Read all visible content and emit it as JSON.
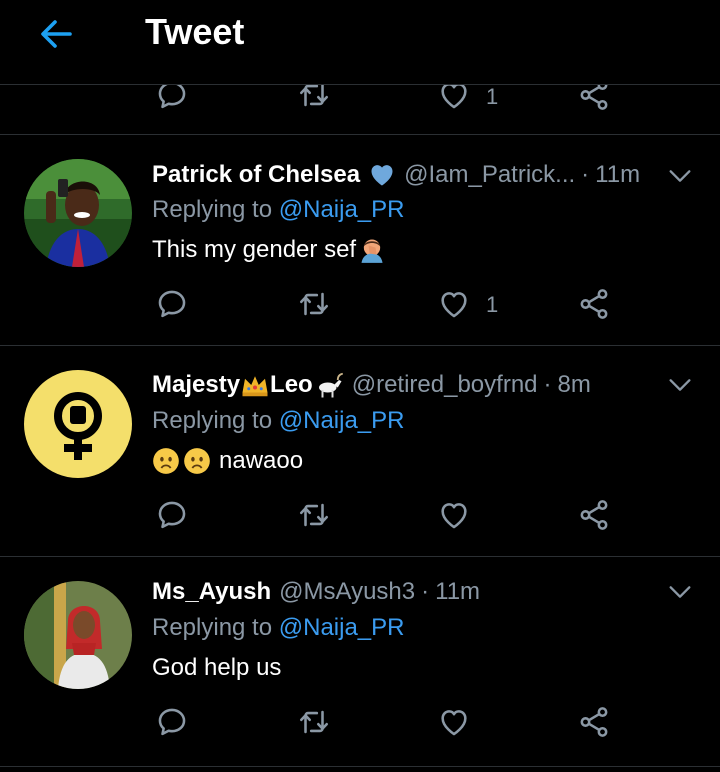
{
  "header": {
    "title": "Tweet",
    "back_icon": "arrow-left-icon"
  },
  "colors": {
    "accent": "#1da1f2",
    "link": "#3b9cf0",
    "muted": "#8b98a5",
    "background": "#000000",
    "divider": "#2b2f33",
    "verified_heart": "#6fa8dc",
    "avatar_majesty_bg": "#f4df6b"
  },
  "top_partial": {
    "like_count": "1"
  },
  "tweets": [
    {
      "name": "Patrick of Chelsea",
      "name_badge": "blue-heart-emoji",
      "handle": "@Iam_Patrick...",
      "dot": "·",
      "time": "11m",
      "replying_prefix": "Replying to ",
      "replying_to": "@Naija_PR",
      "text": "This my gender sef",
      "text_emoji": "facepalm-emoji",
      "like_count": "1"
    },
    {
      "name_a": "Majesty",
      "name_b": "Leo",
      "name_emojis": [
        "crown-emoji",
        "goat-emoji"
      ],
      "handle": "@retired_boyfrnd",
      "dot": "·",
      "time": "8m",
      "replying_prefix": "Replying to ",
      "replying_to": "@Naija_PR",
      "text": "nawaoo",
      "text_emojis": [
        "worried-face-emoji",
        "worried-face-emoji"
      ],
      "like_count": ""
    },
    {
      "name": "Ms_Ayush",
      "handle": "@MsAyush3",
      "dot": "·",
      "time": "11m",
      "replying_prefix": "Replying to ",
      "replying_to": "@Naija_PR",
      "text": "God help us",
      "like_count": ""
    }
  ],
  "action_icons": [
    "reply-icon",
    "retweet-icon",
    "like-icon",
    "share-icon"
  ]
}
